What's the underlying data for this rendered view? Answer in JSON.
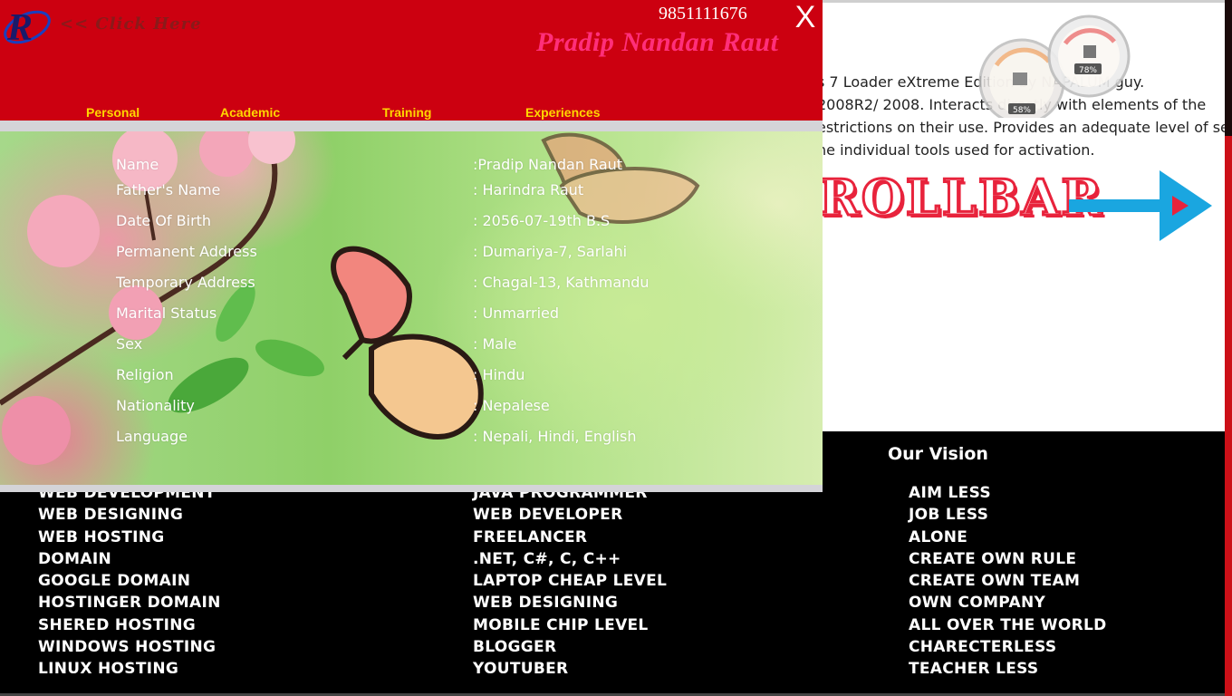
{
  "header": {
    "click_here": "<< Click Here",
    "phone": "9851111676",
    "close": "X",
    "name": "Pradip Nandan Raut"
  },
  "tabs": [
    {
      "label": "Personal"
    },
    {
      "label": "Academic"
    },
    {
      "label": "Training"
    },
    {
      "label": "Experiences"
    }
  ],
  "personal": [
    {
      "label": "Name",
      "value": ":Pradip Nandan Raut"
    },
    {
      "label": "Father's Name",
      "value": ": Harindra Raut"
    },
    {
      "label": "Date Of Birth",
      "value": ": 2056-07-19th B.S"
    },
    {
      "label": "Permanent Address",
      "value": ": Dumariya-7, Sarlahi"
    },
    {
      "label": "Temporary Address",
      "value": ": Chagal-13, Kathmandu"
    },
    {
      "label": "Marital Status",
      "value": ": Unmarried"
    },
    {
      "label": "Sex",
      "value": ": Male"
    },
    {
      "label": "Religion",
      "value": ": Hindu"
    },
    {
      "label": "Nationality",
      "value": ": Nepalese"
    },
    {
      "label": "Language",
      "value": ": Nepali, Hindi, English"
    }
  ],
  "background": {
    "lines": [
      "s 7 Loader eXtreme Edition by NAPALUM guy.",
      "2008R2/ 2008. Interacts directly with elements of the",
      "estrictions on their use. Provides an adequate level of se",
      "he individual tools used for activation."
    ],
    "scrollbar_word": "ROLLBAR",
    "gauge_small": "58%",
    "gauge_large": "78%"
  },
  "footer": {
    "vision_title": "Our Vision",
    "col1": [
      "WEB DEVELOPMENT",
      "WEB DESIGNING",
      "WEB HOSTING",
      "DOMAIN",
      "GOOGLE DOMAIN",
      "HOSTINGER DOMAIN",
      "SHERED HOSTING",
      "WINDOWS HOSTING",
      "LINUX HOSTING"
    ],
    "col2": [
      "JAVA PROGRAMMER",
      "WEB DEVELOPER",
      "FREELANCER",
      ".NET, C#, C, C++",
      "LAPTOP CHEAP LEVEL",
      "WEB DESIGNING",
      "MOBILE CHIP LEVEL",
      "BLOGGER",
      "YOUTUBER"
    ],
    "col3": [
      "AIM LESS",
      "JOB LESS",
      "ALONE",
      "CREATE OWN RULE",
      "CREATE OWN TEAM",
      "OWN COMPANY",
      "ALL OVER THE WORLD",
      "CHARECTERLESS",
      "TEACHER LESS"
    ]
  },
  "colors": {
    "header_red": "#cc0010",
    "tab_yellow": "#ffd700",
    "brand_pink": "#ff2f7a",
    "scrollbar_red": "#e8233c",
    "arrow_blue": "#1aa6e0"
  }
}
